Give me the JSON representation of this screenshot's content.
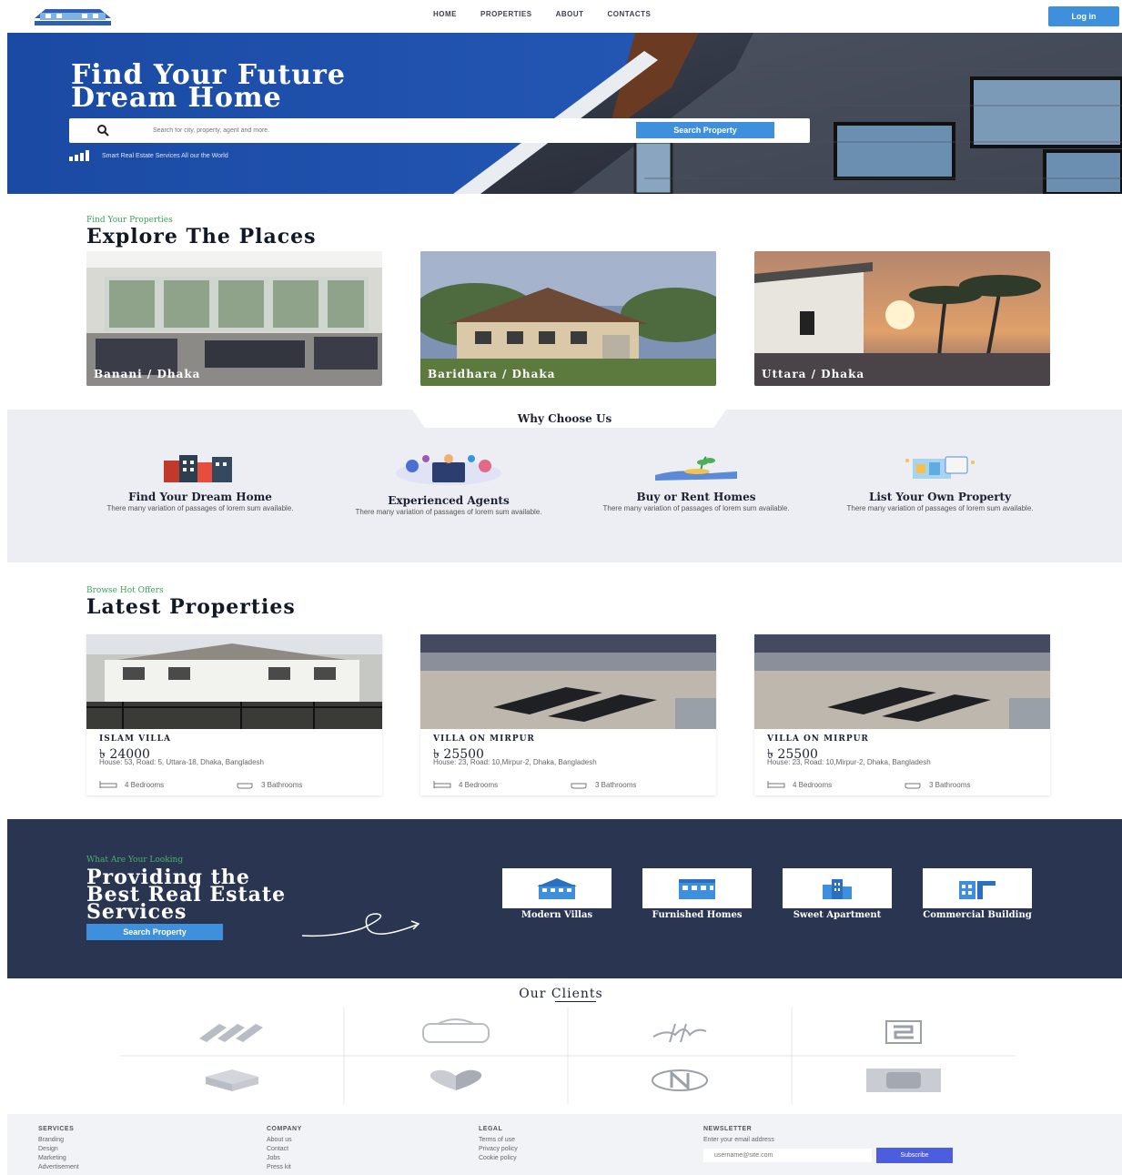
{
  "header": {
    "nav": [
      "HOME",
      "PROPERTIES",
      "ABOUT",
      "CONTACTS"
    ],
    "login_label": "Log in"
  },
  "hero": {
    "title_line1": "Find Your Future",
    "title_line2": "Dream Home",
    "search_placeholder": "Search for city, property, agent and more.",
    "search_button": "Search Property",
    "tagline": "Smart Real Estate Services All our the World"
  },
  "explore": {
    "kicker": "Find Your Properties",
    "title": "Explore The Places",
    "places": [
      "Banani / Dhaka",
      "Baridhara / Dhaka",
      "Uttara / Dhaka"
    ]
  },
  "why": {
    "title": "Why Choose Us",
    "features": [
      {
        "title": "Find Your Dream Home",
        "desc": "There many variation of passages of lorem sum available."
      },
      {
        "title": "Experienced Agents",
        "desc": "There many variation of passages of lorem sum available."
      },
      {
        "title": "Buy or Rent Homes",
        "desc": "There many variation of passages of lorem sum available."
      },
      {
        "title": "List Your Own Property",
        "desc": "There many variation of passages of lorem sum available."
      }
    ]
  },
  "latest": {
    "kicker": "Browse Hot Offers",
    "title": "Latest Properties",
    "cards": [
      {
        "name": "ISLAM VILLA",
        "price": "৳ 24000",
        "address": "House: 53, Road: 5, Uttara-18, Dhaka, Bangladesh",
        "bedrooms": "4 Bedrooms",
        "bathrooms": "3 Bathrooms"
      },
      {
        "name": "VILLA ON MIRPUR",
        "price": "৳ 25500",
        "address": "House: 23, Road: 10,Mirpur-2, Dhaka, Bangladesh",
        "bedrooms": "4 Bedrooms",
        "bathrooms": "3 Bathrooms"
      },
      {
        "name": "VILLA ON MIRPUR",
        "price": "৳ 25500",
        "address": "House: 23, Road: 10,Mirpur-2, Dhaka, Bangladesh",
        "bedrooms": "4 Bedrooms",
        "bathrooms": "3 Bathrooms"
      }
    ]
  },
  "services": {
    "kicker": "What Are Your Looking",
    "title_line1": "Providing the",
    "title_line2": "Best Real Estate",
    "title_line3": "Services",
    "button": "Search Property",
    "items": [
      "Modern Villas",
      "Furnished Homes",
      "Sweet Apartment",
      "Commercial Building"
    ]
  },
  "clients": {
    "title": "Our Clients"
  },
  "footer": {
    "columns": [
      {
        "heading": "SERVICES",
        "links": [
          "Branding",
          "Design",
          "Marketing",
          "Advertisement"
        ]
      },
      {
        "heading": "COMPANY",
        "links": [
          "About us",
          "Contact",
          "Jobs",
          "Press kit"
        ]
      },
      {
        "heading": "LEGAL",
        "links": [
          "Terms of use",
          "Privacy policy",
          "Cookie policy"
        ]
      }
    ],
    "newsletter": {
      "heading": "NEWSLETTER",
      "label": "Enter your email address",
      "placeholder": "username@site.com",
      "button": "Subscribe"
    }
  },
  "colors": {
    "primary_blue": "#3e8fdc",
    "hero_blue": "#1d4ea6",
    "dark_navy": "#2a3552",
    "kicker_green": "#3aa35a",
    "subscribe_indigo": "#4d5de0"
  }
}
